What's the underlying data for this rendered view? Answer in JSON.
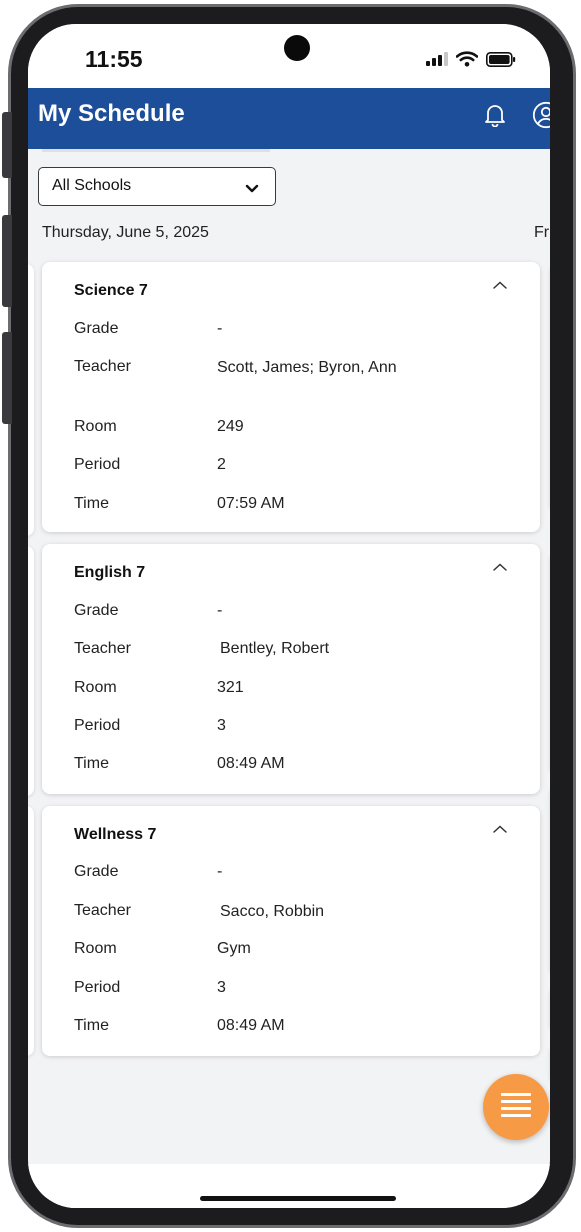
{
  "status_bar": {
    "time": "11:55"
  },
  "header": {
    "title": "My Schedule",
    "notifications_icon": "bell-icon",
    "account_icon": "user-circle-icon",
    "background_color": "#1d4e9a"
  },
  "school_filter": {
    "selected": "All Schools"
  },
  "day": {
    "date": "Thursday, June 5, 2025",
    "next_date_partial": "Fr"
  },
  "labels": {
    "grade": "Grade",
    "teacher": "Teacher",
    "room": "Room",
    "period": "Period",
    "time": "Time"
  },
  "classes": [
    {
      "name": "Science 7",
      "grade": "-",
      "teacher": "Scott, James; Byron, Ann",
      "room": "249",
      "period": "2",
      "time": "07:59 AM"
    },
    {
      "name": "English 7",
      "grade": "-",
      "teacher": "Bentley, Robert",
      "room": "321",
      "period": "3",
      "time": "08:49 AM"
    },
    {
      "name": "Wellness 7",
      "grade": "-",
      "teacher": "Sacco, Robbin",
      "room": "Gym",
      "period": "3",
      "time": "08:49 AM"
    }
  ],
  "fab": {
    "icon": "menu-icon",
    "color": "#f79a46"
  }
}
